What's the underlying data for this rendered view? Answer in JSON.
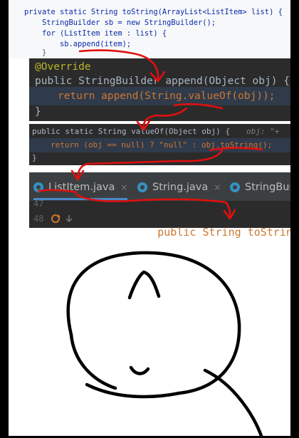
{
  "panel1": {
    "line1": "private static String toString(ArrayList<ListItem> list) {",
    "line2": "StringBuilder sb = new StringBuilder();",
    "line3": "for (ListItem item : list) {",
    "line4": "sb.append(item);",
    "line5": "}"
  },
  "panel2": {
    "line1": "@Override",
    "line2": "public StringBuilder append(Object obj) {",
    "line3": "return append(String.valueOf(obj));",
    "line4": "}"
  },
  "panel3": {
    "line1": "public static String valueOf(Object obj) {",
    "line1_hint": "obj: \"+",
    "line2": "return (obj == null) ? \"null\" : obj.toString();",
    "line3": "}"
  },
  "panel4": {
    "tabs": [
      {
        "label": "ListItem.java",
        "close": "×"
      },
      {
        "label": "String.java",
        "close": "×"
      },
      {
        "label": "StringBuil",
        "close": ""
      }
    ],
    "line_numbers": [
      "47",
      "48"
    ],
    "code_line": "public String toString() {"
  },
  "colors": {
    "arrow": "#e0100e",
    "dark_bg": "#2b2b2b",
    "light_bg": "#f7f8fa"
  }
}
